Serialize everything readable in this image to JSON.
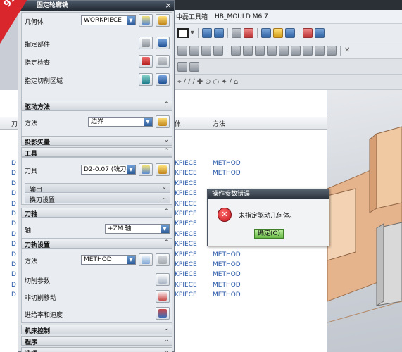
{
  "app": {
    "menubar": [
      "中磊工具箱",
      "HB_MOULD M6.7"
    ]
  },
  "dialog": {
    "title": "固定轮廓铣",
    "close": "×",
    "geometry": {
      "geometry_label": "几何体",
      "geometry_value": "WORKPIECE",
      "part_label": "指定部件",
      "check_label": "指定检查",
      "cut_area_label": "指定切削区域"
    },
    "drive": {
      "header": "驱动方法",
      "method_label": "方法",
      "method_value": "边界"
    },
    "projection": {
      "header": "投影矢量"
    },
    "tool": {
      "header": "工具",
      "tool_label": "刀具",
      "tool_value": "D2-0.07 (铣刀-",
      "output_label": "输出",
      "tool_change_label": "换刀设置"
    },
    "axis": {
      "header": "刀轴",
      "axis_label": "轴",
      "axis_value": "+ZM 轴"
    },
    "path": {
      "header": "刀轨设置",
      "method_label": "方法",
      "method_value": "METHOD",
      "cut_params_label": "切削参数",
      "non_cut_label": "非切削移动",
      "feeds_label": "进给率和速度"
    },
    "machine": {
      "header": "机床控制"
    },
    "program": {
      "header": "程序"
    },
    "options": {
      "header": "选项"
    }
  },
  "navigator": {
    "col_geometry": "体",
    "col_method": "方法",
    "col_left": "刀",
    "rows": [
      {
        "left": "D",
        "geometry": "KPIECE",
        "method": "METHOD"
      },
      {
        "left": "D",
        "geometry": "KPIECE",
        "method": "METHOD"
      },
      {
        "left": "D",
        "geometry": "KPIECE",
        "method": ""
      },
      {
        "left": "D",
        "geometry": "KPIECE",
        "method": ""
      },
      {
        "left": "D",
        "geometry": "KPIECE",
        "method": ""
      },
      {
        "left": "D",
        "geometry": "KPIECE",
        "method": ""
      },
      {
        "left": "D",
        "geometry": "KPIECE",
        "method": "METHOD"
      },
      {
        "left": "D",
        "geometry": "KPIECE",
        "method": "METHOD"
      },
      {
        "left": "D",
        "geometry": "KPIECE",
        "method": "METHOD"
      },
      {
        "left": "D",
        "geometry": "KPIECE",
        "method": "METHOD"
      },
      {
        "left": "D",
        "geometry": "KPIECE",
        "method": "METHOD"
      },
      {
        "left": "D",
        "geometry": "KPIECE",
        "method": "METHOD"
      },
      {
        "left": "D",
        "geometry": "KPIECE",
        "method": "METHOD"
      },
      {
        "left": "D",
        "geometry": "KPIECE",
        "method": "METHOD"
      }
    ]
  },
  "popup": {
    "title": "操作参数错误",
    "message": "未指定驱动几何体。",
    "ok_label": "确定(O)"
  },
  "watermark": {
    "line1": "9SUG",
    "line2": "学UG就上UG网"
  },
  "colors": {
    "dialog_bg": "#dfe3e8",
    "title_bar": "#232a33",
    "link_blue": "#2556a8",
    "error_red": "#c4151c",
    "ok_green": "#67b845"
  }
}
